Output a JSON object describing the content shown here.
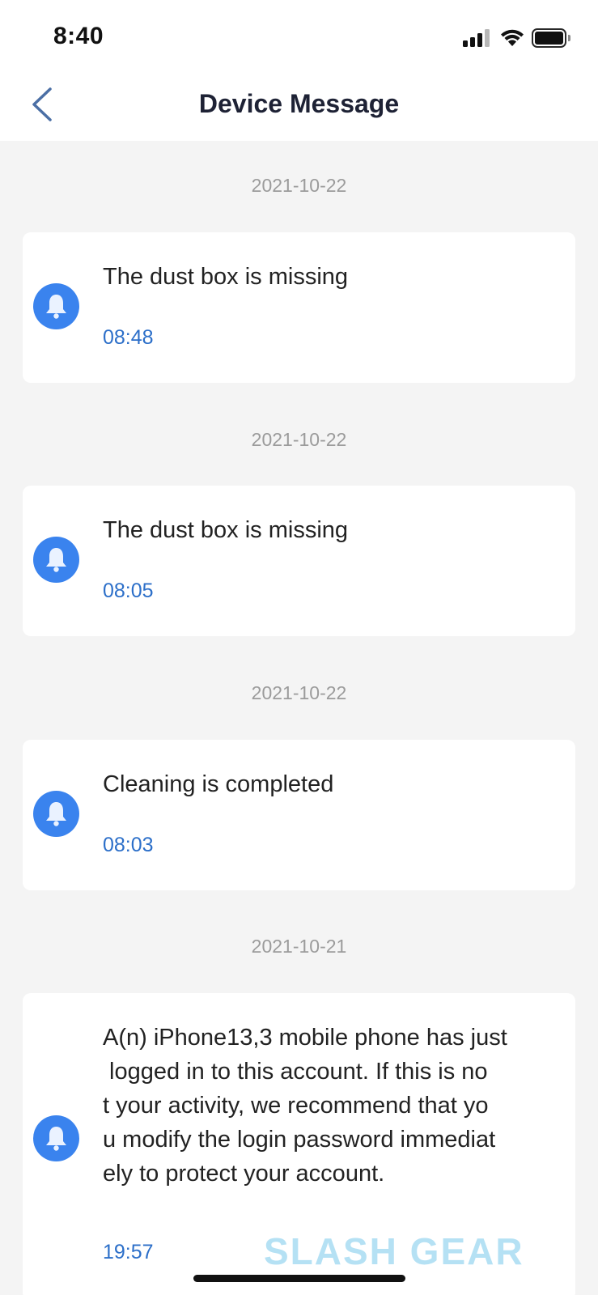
{
  "status_bar": {
    "time": "8:40"
  },
  "header": {
    "title": "Device Message"
  },
  "messages": [
    {
      "date": "2021-10-22",
      "text": "The dust box is missing",
      "time": "08:48"
    },
    {
      "date": "2021-10-22",
      "text": "The dust box is missing",
      "time": "08:05"
    },
    {
      "date": "2021-10-22",
      "text": "Cleaning is completed",
      "time": "08:03"
    },
    {
      "date": "2021-10-21",
      "text_lines": [
        "A(n) iPhone13,3 mobile phone has just",
        " logged in to this account. If this is no",
        "t your activity, we recommend that yo",
        "u modify the login password immediat",
        "ely to protect your account."
      ],
      "time": "19:57"
    }
  ],
  "watermark": "SLASH GEAR",
  "colors": {
    "accent": "#3a83ee",
    "time_blue": "#2c6fc9",
    "background": "#f4f4f4"
  },
  "icons": {
    "message_icon": "bell-icon",
    "back": "chevron-left-icon"
  }
}
